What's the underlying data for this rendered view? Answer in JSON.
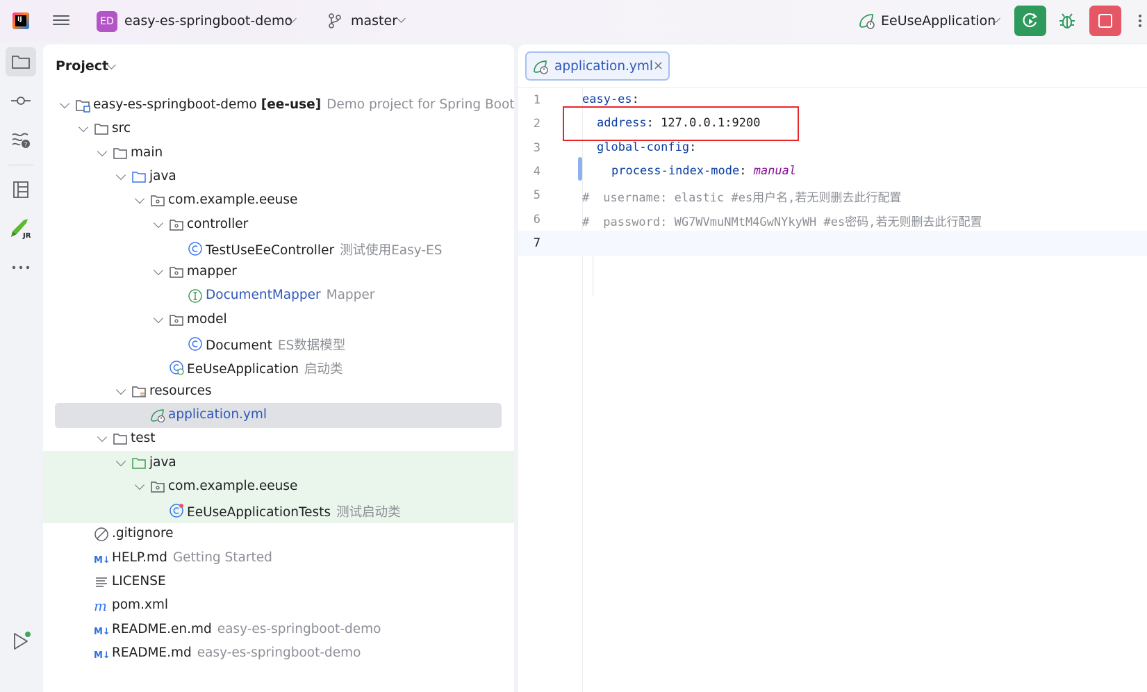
{
  "toolbar": {
    "project_initials": "ED",
    "project_name": "easy-es-springboot-demo",
    "branch": "master",
    "run_config": "EeUseApplication"
  },
  "project_panel": {
    "title": "Project",
    "tree": [
      {
        "label": "easy-es-springboot-demo",
        "bold_suffix": "[ee-use]",
        "hint": "Demo project for Spring Boot  - C",
        "icon": "module-folder-icon"
      },
      {
        "label": "src",
        "icon": "folder-icon"
      },
      {
        "label": "main",
        "icon": "folder-icon"
      },
      {
        "label": "java",
        "icon": "source-folder-icon"
      },
      {
        "label": "com.example.eeuse",
        "icon": "package-icon"
      },
      {
        "label": "controller",
        "icon": "package-icon"
      },
      {
        "label": "TestUseEeController",
        "hint": "测试使用Easy-ES",
        "icon": "class-icon"
      },
      {
        "label": "mapper",
        "icon": "package-icon"
      },
      {
        "label": "DocumentMapper",
        "hint": "Mapper",
        "icon": "interface-icon"
      },
      {
        "label": "model",
        "icon": "package-icon"
      },
      {
        "label": "Document",
        "hint": "ES数据模型",
        "icon": "class-icon"
      },
      {
        "label": "EeUseApplication",
        "hint": "启动类",
        "icon": "spring-boot-class-icon"
      },
      {
        "label": "resources",
        "icon": "resources-folder-icon"
      },
      {
        "label": "application.yml",
        "icon": "spring-yml-icon"
      },
      {
        "label": "test",
        "icon": "folder-icon"
      },
      {
        "label": "java",
        "icon": "test-folder-icon"
      },
      {
        "label": "com.example.eeuse",
        "icon": "package-icon"
      },
      {
        "label": "EeUseApplicationTests",
        "hint": "测试启动类",
        "icon": "test-class-icon"
      },
      {
        "label": ".gitignore",
        "icon": "gitignore-icon"
      },
      {
        "label": "HELP.md",
        "hint": "Getting Started",
        "icon": "markdown-icon"
      },
      {
        "label": "LICENSE",
        "icon": "text-file-icon"
      },
      {
        "label": "pom.xml",
        "icon": "maven-icon"
      },
      {
        "label": "README.en.md",
        "hint": "easy-es-springboot-demo",
        "icon": "markdown-icon"
      },
      {
        "label": "README.md",
        "hint": "easy-es-springboot-demo",
        "icon": "markdown-icon"
      }
    ]
  },
  "editor": {
    "tab_name": "application.yml",
    "tab_close": "×",
    "lines": [
      {
        "n": "1",
        "k": "easy-es",
        "p": ":"
      },
      {
        "n": "2",
        "k": "address",
        "p": ": ",
        "v": "127.0.0.1:9200"
      },
      {
        "n": "3",
        "k": "global-config",
        "p": ":"
      },
      {
        "n": "4",
        "k": "process-index-mode",
        "p": ": ",
        "v": "manual"
      },
      {
        "n": "5",
        "hash": "#",
        "comment": "username: elastic #es用户名,若无则删去此行配置"
      },
      {
        "n": "6",
        "hash": "#",
        "comment": "password: WG7WVmuNMtM4GwNYkyWH #es密码,若无则删去此行配置"
      },
      {
        "n": "7"
      }
    ]
  },
  "colors": {
    "accent_blue": "#2f58b8",
    "run_green": "#2e9a5b",
    "stop_red": "#e55765",
    "highlight_red": "#e8272b",
    "project_badge": "#b455c7"
  }
}
